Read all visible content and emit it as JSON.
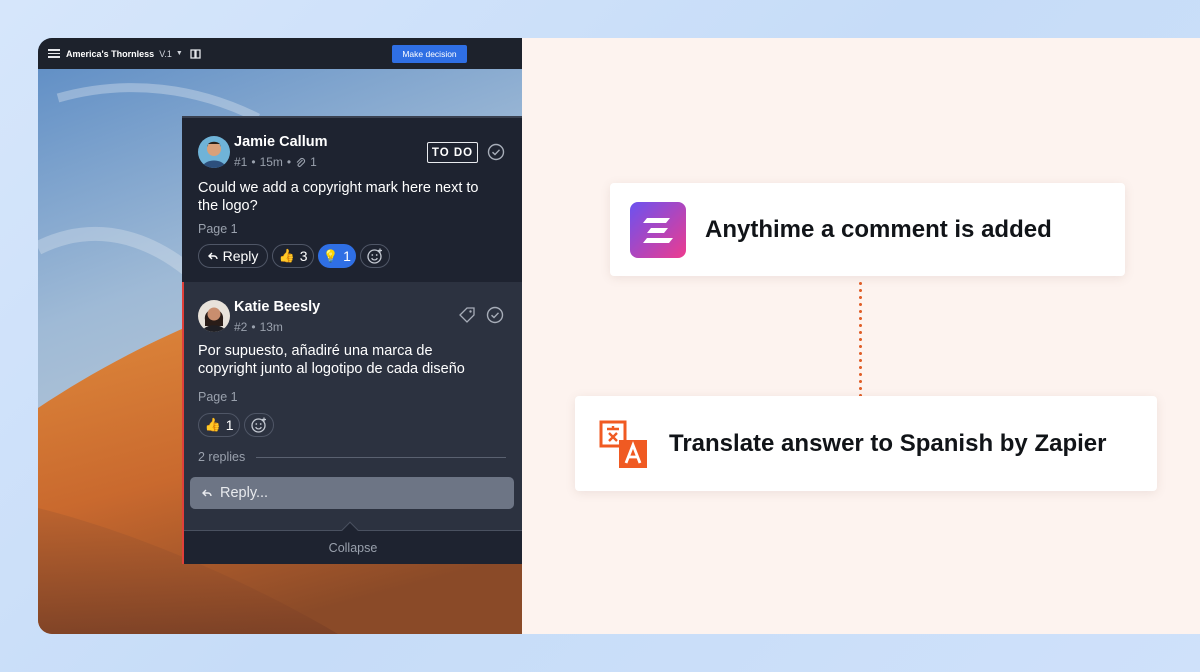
{
  "app": {
    "project_title": "America's Thornless",
    "version": "V.1",
    "make_decision_label": "Make decision"
  },
  "comments": [
    {
      "author": "Jamie Callum",
      "number": "#1",
      "time": "15m",
      "attachments": "1",
      "status_badge": "TO DO",
      "text_line1": "Could we add a copyright mark here next to",
      "text_line2": "the logo?",
      "page": "Page 1",
      "reply_label": "Reply",
      "thumbs_count": "3",
      "idea_count": "1"
    },
    {
      "author": "Katie Beesly",
      "number": "#2",
      "time": "13m",
      "text_line1": "Por supuesto, añadiré una marca de",
      "text_line2": "copyright junto al logotipo de cada diseño",
      "page": "Page 1",
      "thumbs_count": "1",
      "replies_label": "2 replies",
      "reply_placeholder": "Reply...",
      "collapse_label": "Collapse"
    }
  ],
  "workflow": {
    "trigger_label": "Anythime a comment is added",
    "action_label": "Translate answer to Spanish by Zapier",
    "connector_color": "#e0602a"
  },
  "colors": {
    "accent_blue": "#2f6fe4",
    "comment_bg_dark": "#1e2330",
    "comment_bg": "#2c3240",
    "unread_marker": "#e0403a",
    "translate_orange": "#f05a22"
  },
  "icons": {
    "trigger": "zeplin-style-z-logo",
    "action": "translate-icon"
  }
}
